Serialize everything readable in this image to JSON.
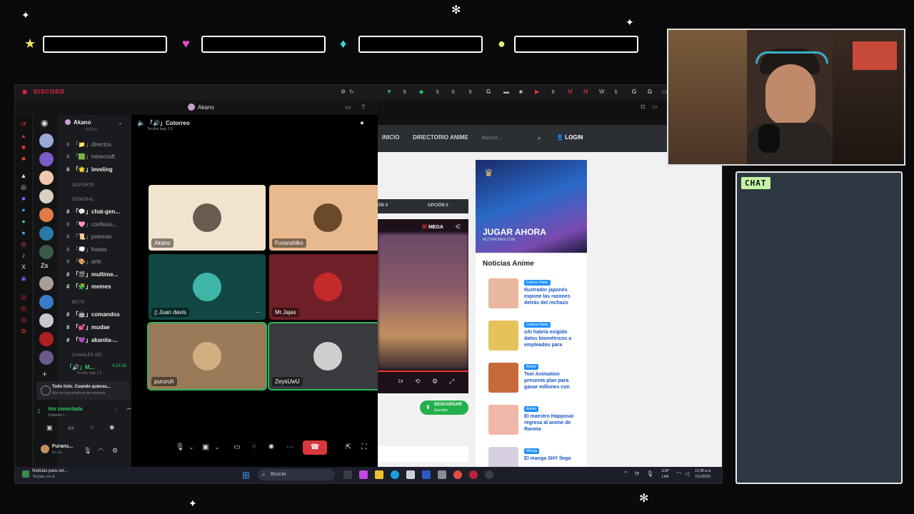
{
  "overlay": {
    "hud_icons": [
      "star-icon",
      "heart-icon",
      "diamond-icon",
      "coin-icon"
    ],
    "hud_colors": [
      "#f3e46a",
      "#e84ac0",
      "#38d6d6",
      "#e8f07a"
    ],
    "chat_title": "CHAT"
  },
  "window": {
    "brand": "DISCORD",
    "tab_user": "Akano",
    "server_name": "Akano",
    "server_icon_label": "Zs"
  },
  "channels": {
    "videos": "videos",
    "items": [
      {
        "label": "「📁」directos"
      },
      {
        "label": "「🟩」minecraft"
      },
      {
        "label": "「🌟」leveling"
      },
      {
        "label": "「💬」chat-gen..."
      },
      {
        "label": "「🩷」confesio..."
      },
      {
        "label": "「📜」poemas"
      },
      {
        "label": "「💭」frases"
      },
      {
        "label": "「🎨」arte"
      },
      {
        "label": "「🎬」multime..."
      },
      {
        "label": "「🧩」memes"
      },
      {
        "label": "「🤖」comandos"
      },
      {
        "label": "「💕」mudae"
      },
      {
        "label": "「💜」akanita-..."
      }
    ],
    "categories": {
      "soporte": "SOPORTE",
      "general": "GENERAL",
      "bots": "BOTS",
      "voice": "CANALES DE..."
    },
    "voice_channel_short": "「🔊」M...",
    "voice_timer": "4:15:28",
    "voice_sub": "Terrible baje 2.0",
    "notice_title": "Todo listo. Cuando quieras...",
    "notice_sub": "Aún no hay progreso de misiones",
    "voice_connected": "Voz conectada",
    "voice_connected_sub": "Cotorreo /...",
    "user_name": "Furans...",
    "user_status": "En ca..."
  },
  "call": {
    "channel_title": "「🔊」Cotorreo",
    "channel_sub": "Terrible baje 2.0",
    "participants": [
      {
        "name": "Akano",
        "bg": "#f2e3cf",
        "av": "#6b5a50"
      },
      {
        "name": "Furanshiko",
        "bg": "#e8b98c",
        "av": "#6a4a2a"
      },
      {
        "name": "Juan davis",
        "bg": "#114843",
        "av": "#3fb6a8"
      },
      {
        "name": "Mr.Jajas",
        "bg": "#6e1f28",
        "av": "#c42a2a"
      },
      {
        "name": "pururuh",
        "bg": "#9b7a5a",
        "av": "#d0b080"
      },
      {
        "name": "ZeysUwU",
        "bg": "#3a3b3e",
        "av": "#cfcfcf"
      }
    ]
  },
  "web": {
    "nav": [
      "INICIO",
      "DIRECTORIO ANIME"
    ],
    "search_placeholder": "Buscar...",
    "login": "LOGIN",
    "tabs": [
      "ÓN 4",
      "OPCIÓN 5"
    ],
    "player_brand": "MEGA",
    "player_speed": "1x",
    "download_label": "DESCARGAR",
    "download_sub": "Episodio",
    "ad_title": "JUGAR AHORA",
    "ad_sub": "MUTHRONES.COM",
    "news_heading": "Noticias Anime",
    "news": [
      {
        "tag": "Cultura Otaku",
        "title": "Ilustrador japonés expone las razones detrás del rechazo",
        "color": "#e9b7a0"
      },
      {
        "tag": "Cultura Otaku",
        "title": "xAI habría exigido datos biométricos a empleados para",
        "color": "#e6c25a"
      },
      {
        "tag": "Anime",
        "title": "Toei Animation presenta plan para ganar millones con",
        "color": "#c76a3a"
      },
      {
        "tag": "Anime",
        "title": "El maestro Happosai regresa al anime de Ranma",
        "color": "#f0b8a8"
      },
      {
        "tag": "Manga",
        "title": "El manga SHY llega",
        "color": "#d7d0e0"
      }
    ]
  },
  "taskbar": {
    "notif_title": "Noticias para ust...",
    "notif_sub": "\"Actúan con d...",
    "search": "Buscar",
    "lang": "ESP",
    "lang_sub": "LAA",
    "time": "12:38 a.m.",
    "date": "7/11/2025"
  }
}
